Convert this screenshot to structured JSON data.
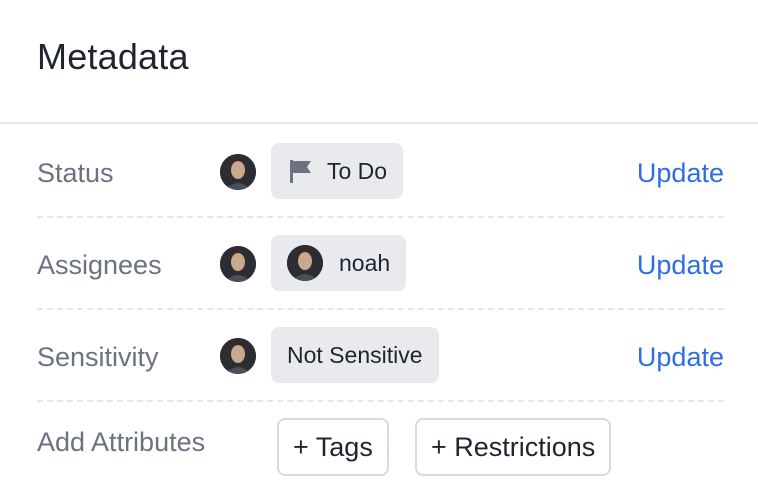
{
  "header": {
    "title": "Metadata"
  },
  "rows": [
    {
      "label": "Status",
      "value": "To Do",
      "action": "Update"
    },
    {
      "label": "Assignees",
      "value": "noah",
      "action": "Update"
    },
    {
      "label": "Sensitivity",
      "value": "Not Sensitive",
      "action": "Update"
    }
  ],
  "attributes": {
    "label": "Add Attributes",
    "buttons": [
      "+ Tags",
      "+ Restrictions"
    ]
  },
  "colors": {
    "accent": "#2f6ee0",
    "muted_text": "#6b7280",
    "pill_bg": "#e8eaee"
  },
  "icons": {
    "status": "flag-icon",
    "avatar": "avatar"
  }
}
